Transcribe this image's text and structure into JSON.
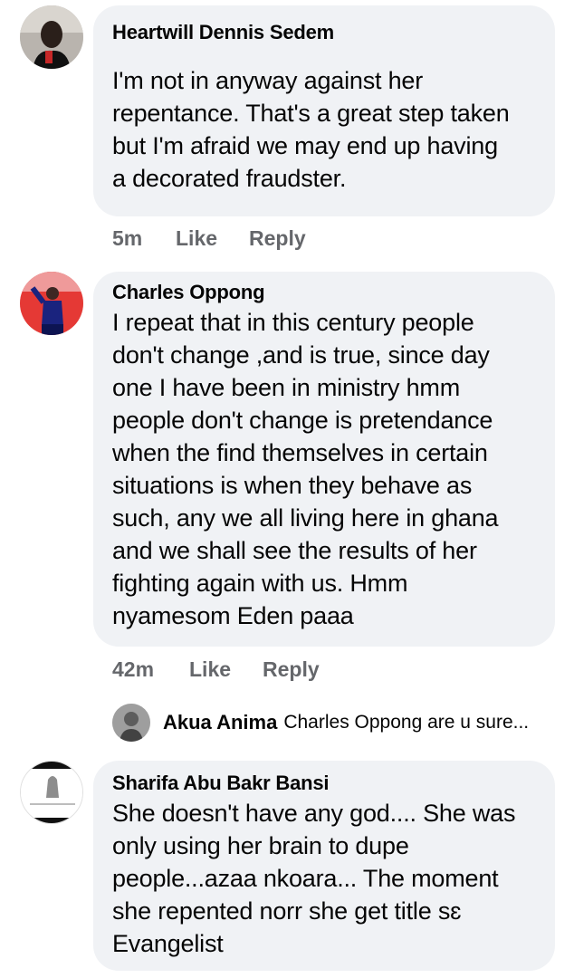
{
  "comments": [
    {
      "author": "Heartwill Dennis Sedem",
      "text_lines": [
        "I'm not in anyway against her",
        "repentance. That's a great step taken",
        "but I'm afraid we may end up having",
        "a decorated fraudster."
      ],
      "time": "5m",
      "like": "Like",
      "reply": "Reply"
    },
    {
      "author": "Charles Oppong",
      "text_lines": [
        "I repeat that in this century people",
        "don't change ,and is true, since day",
        "one I have been in ministry hmm",
        "people don't change is pretendance",
        "when the find themselves in certain",
        "situations is when they behave as",
        "such, any we all living here in ghana",
        "and we shall see the results of her",
        "fighting again with us. Hmm",
        "nyamesom Eden paaa"
      ],
      "time": "42m",
      "like": "Like",
      "reply": "Reply",
      "reply_preview": {
        "author": "Akua Anima",
        "text": "Charles Oppong are u sure..."
      }
    },
    {
      "author": "Sharifa Abu Bakr Bansi",
      "text_lines": [
        "She doesn't have any god.... She was",
        "only using her brain to dupe",
        "people...azaa nkoara... The moment",
        "she repented norr she get title sɛ",
        "Evangelist"
      ]
    }
  ],
  "colors": {
    "bubble": "#f0f2f5",
    "text": "#050505",
    "meta": "#65676b"
  }
}
